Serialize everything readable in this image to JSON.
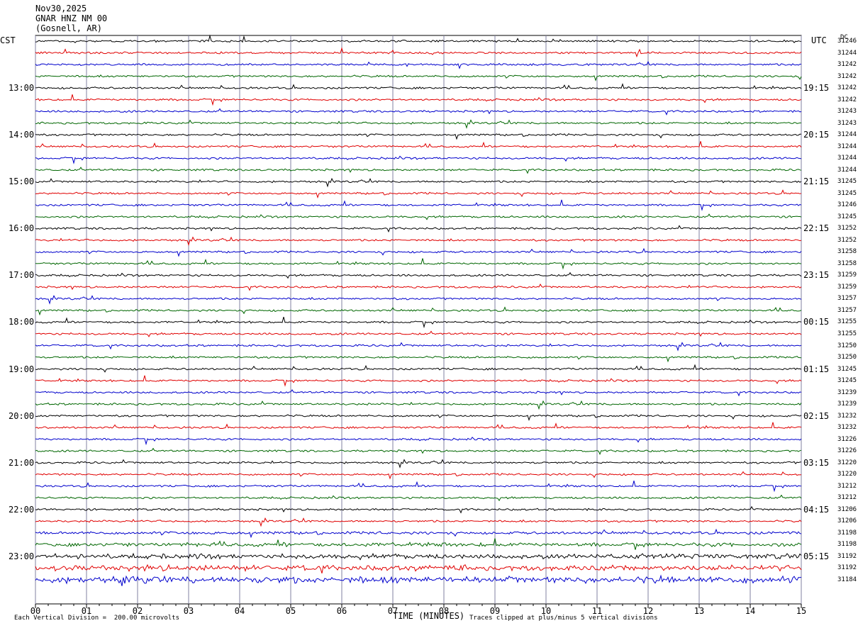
{
  "header": {
    "date": "Nov30,2025",
    "station": "GNAR HNZ NM 00",
    "location": "(Gosnell, AR)"
  },
  "left_tz": "CST",
  "right_tz": "UTC",
  "dc_label": "DC",
  "footer": {
    "scale_note": "Each Vertical Division =  200.00 microvolts",
    "clip_note": "Traces clipped at plus/minus 5 vertical divisions"
  },
  "colors": {
    "trace": [
      "#000000",
      "#e00000",
      "#0000cc",
      "#006600"
    ],
    "grid": "#8080a0"
  },
  "chart_data": {
    "type": "line",
    "title": "",
    "xlabel": "TIME (MINUTES)",
    "xlim": [
      0,
      15
    ],
    "x_ticks": [
      "00",
      "01",
      "02",
      "03",
      "04",
      "05",
      "06",
      "07",
      "08",
      "09",
      "10",
      "11",
      "12",
      "13",
      "14",
      "15"
    ],
    "left_hour_labels": [
      "13:00",
      "14:00",
      "15:00",
      "16:00",
      "17:00",
      "18:00",
      "19:00",
      "20:00",
      "21:00",
      "22:00",
      "23:00"
    ],
    "right_hour_labels": [
      "19:15",
      "20:15",
      "21:15",
      "22:15",
      "23:15",
      "00:15",
      "01:15",
      "02:15",
      "03:15",
      "04:15",
      "05:15"
    ],
    "dc_values": [
      "31246",
      "31244",
      "31242",
      "31242",
      "31242",
      "31242",
      "31243",
      "31243",
      "31244",
      "31244",
      "31244",
      "31244",
      "31245",
      "31245",
      "31246",
      "31245",
      "31252",
      "31252",
      "31258",
      "31258",
      "31259",
      "31259",
      "31257",
      "31257",
      "31255",
      "31255",
      "31250",
      "31250",
      "31245",
      "31245",
      "31239",
      "31239",
      "31232",
      "31232",
      "31226",
      "31226",
      "31220",
      "31220",
      "31212",
      "31212",
      "31206",
      "31206",
      "31198",
      "31198",
      "31192",
      "31192",
      "31184"
    ],
    "trace_count": 47
  }
}
